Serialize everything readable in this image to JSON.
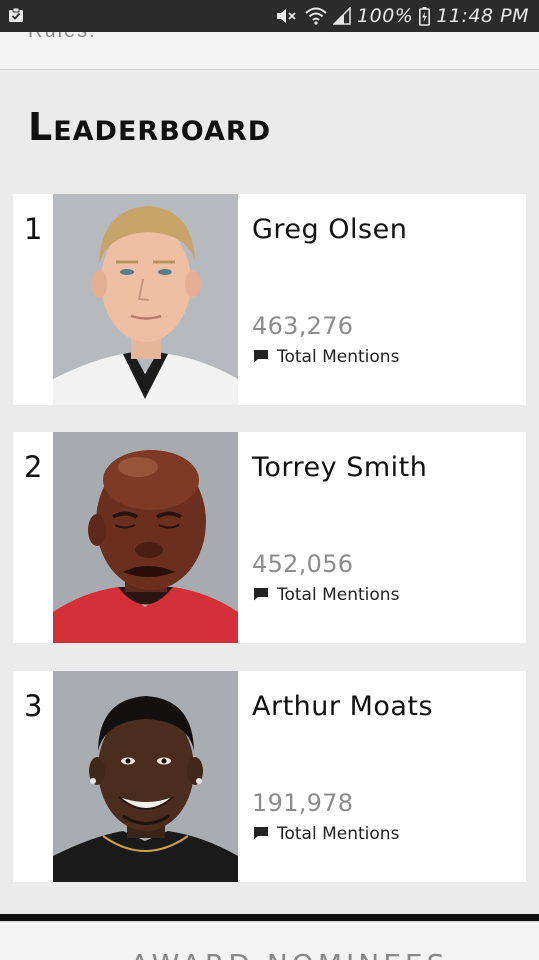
{
  "status_bar": {
    "battery": "100%",
    "time": "11:48 PM"
  },
  "top_strip": {
    "text": "Rules."
  },
  "page": {
    "title": "Leaderboard"
  },
  "leaderboard": [
    {
      "rank": "1",
      "name": "Greg Olsen",
      "count": "463,276",
      "label": "Total Mentions"
    },
    {
      "rank": "2",
      "name": "Torrey Smith",
      "count": "452,056",
      "label": "Total Mentions"
    },
    {
      "rank": "3",
      "name": "Arthur Moats",
      "count": "191,978",
      "label": "Total Mentions"
    }
  ],
  "bottom_strip": {
    "text": "AWARD NOMINEES"
  }
}
